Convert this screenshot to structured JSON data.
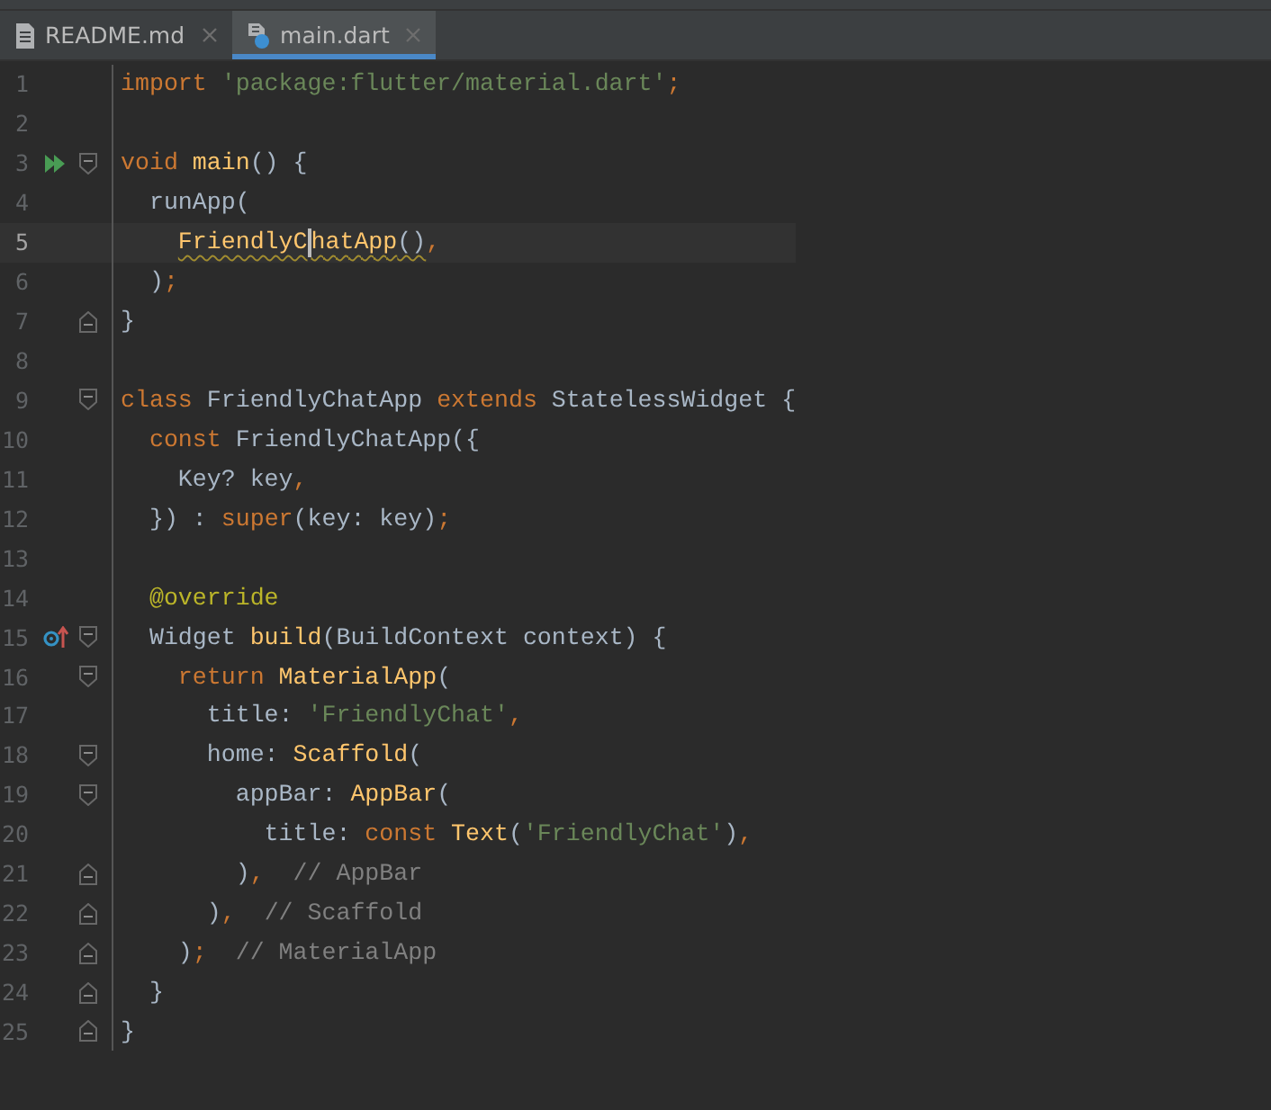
{
  "tabs": [
    {
      "label": "README.md",
      "kind": "text",
      "selected": false
    },
    {
      "label": "main.dart",
      "kind": "dart",
      "selected": true
    }
  ],
  "lines": [
    {
      "number": "1",
      "tokens": [
        {
          "kind": "keyword",
          "text": "import "
        },
        {
          "kind": "string",
          "text": "'package:flutter/material.dart'"
        },
        {
          "kind": "keyword",
          "text": ";"
        }
      ]
    },
    {
      "number": "2"
    },
    {
      "number": "3",
      "gutter": {
        "kind": "run"
      },
      "fold": {
        "kind": "start"
      },
      "tokens": [
        {
          "kind": "keyword",
          "text": "void "
        },
        {
          "kind": "func",
          "text": "main"
        },
        {
          "kind": "plain",
          "text": "() {"
        }
      ]
    },
    {
      "number": "4",
      "tokens": [
        {
          "kind": "plain",
          "text": "  runApp("
        }
      ]
    },
    {
      "number": "5",
      "current": true,
      "tokens": [
        {
          "kind": "func",
          "text": "    FriendlyC",
          "squiggle": true,
          "caret": true
        },
        {
          "kind": "func",
          "text": "hatApp",
          "squiggle": true
        },
        {
          "kind": "plain",
          "text": "()",
          "squiggle": true
        },
        {
          "kind": "keyword",
          "text": ","
        }
      ]
    },
    {
      "number": "6",
      "tokens": [
        {
          "kind": "plain",
          "text": "  )"
        },
        {
          "kind": "keyword",
          "text": ";"
        }
      ]
    },
    {
      "number": "7",
      "fold": {
        "kind": "end"
      },
      "tokens": [
        {
          "kind": "plain",
          "text": "}"
        }
      ]
    },
    {
      "number": "8"
    },
    {
      "number": "9",
      "fold": {
        "kind": "start"
      },
      "tokens": [
        {
          "kind": "keyword",
          "text": "class "
        },
        {
          "kind": "plain",
          "text": "FriendlyChatApp "
        },
        {
          "kind": "keyword",
          "text": "extends "
        },
        {
          "kind": "plain",
          "text": "StatelessWidget {"
        }
      ]
    },
    {
      "number": "10",
      "tokens": [
        {
          "kind": "keyword",
          "text": "  const "
        },
        {
          "kind": "plain",
          "text": "FriendlyChatApp({"
        }
      ]
    },
    {
      "number": "11",
      "tokens": [
        {
          "kind": "plain",
          "text": "    Key? key"
        },
        {
          "kind": "keyword",
          "text": ","
        }
      ]
    },
    {
      "number": "12",
      "tokens": [
        {
          "kind": "plain",
          "text": "  }) : "
        },
        {
          "kind": "keyword",
          "text": "super"
        },
        {
          "kind": "plain",
          "text": "(key: key)"
        },
        {
          "kind": "keyword",
          "text": ";"
        }
      ]
    },
    {
      "number": "13"
    },
    {
      "number": "14",
      "tokens": [
        {
          "kind": "annotation",
          "text": "  @override"
        }
      ]
    },
    {
      "number": "15",
      "gutter": {
        "kind": "override"
      },
      "fold": {
        "kind": "start"
      },
      "tokens": [
        {
          "kind": "plain",
          "text": "  Widget "
        },
        {
          "kind": "func",
          "text": "build"
        },
        {
          "kind": "plain",
          "text": "(BuildContext context) {"
        }
      ]
    },
    {
      "number": "16",
      "fold": {
        "kind": "start"
      },
      "tokens": [
        {
          "kind": "keyword",
          "text": "    return "
        },
        {
          "kind": "func",
          "text": "MaterialApp"
        },
        {
          "kind": "plain",
          "text": "("
        }
      ]
    },
    {
      "number": "17",
      "tokens": [
        {
          "kind": "plain",
          "text": "      title: "
        },
        {
          "kind": "string",
          "text": "'FriendlyChat'"
        },
        {
          "kind": "keyword",
          "text": ","
        }
      ]
    },
    {
      "number": "18",
      "fold": {
        "kind": "start"
      },
      "tokens": [
        {
          "kind": "plain",
          "text": "      home: "
        },
        {
          "kind": "func",
          "text": "Scaffold"
        },
        {
          "kind": "plain",
          "text": "("
        }
      ]
    },
    {
      "number": "19",
      "fold": {
        "kind": "start"
      },
      "tokens": [
        {
          "kind": "plain",
          "text": "        appBar: "
        },
        {
          "kind": "func",
          "text": "AppBar"
        },
        {
          "kind": "plain",
          "text": "("
        }
      ]
    },
    {
      "number": "20",
      "tokens": [
        {
          "kind": "plain",
          "text": "          title: "
        },
        {
          "kind": "keyword",
          "text": "const "
        },
        {
          "kind": "func",
          "text": "Text"
        },
        {
          "kind": "plain",
          "text": "("
        },
        {
          "kind": "string",
          "text": "'FriendlyChat'"
        },
        {
          "kind": "plain",
          "text": ")"
        },
        {
          "kind": "keyword",
          "text": ","
        }
      ]
    },
    {
      "number": "21",
      "fold": {
        "kind": "end"
      },
      "tokens": [
        {
          "kind": "plain",
          "text": "        )"
        },
        {
          "kind": "keyword",
          "text": ","
        },
        {
          "kind": "comment",
          "text": "  // AppBar"
        }
      ]
    },
    {
      "number": "22",
      "fold": {
        "kind": "end"
      },
      "tokens": [
        {
          "kind": "plain",
          "text": "      )"
        },
        {
          "kind": "keyword",
          "text": ","
        },
        {
          "kind": "comment",
          "text": "  // Scaffold"
        }
      ]
    },
    {
      "number": "23",
      "fold": {
        "kind": "end"
      },
      "tokens": [
        {
          "kind": "plain",
          "text": "    )"
        },
        {
          "kind": "keyword",
          "text": ";"
        },
        {
          "kind": "comment",
          "text": "  // MaterialApp"
        }
      ]
    },
    {
      "number": "24",
      "fold": {
        "kind": "end"
      },
      "tokens": [
        {
          "kind": "plain",
          "text": "  }"
        }
      ]
    },
    {
      "number": "25",
      "fold": {
        "kind": "end"
      },
      "tokens": [
        {
          "kind": "plain",
          "text": "}"
        }
      ]
    }
  ]
}
